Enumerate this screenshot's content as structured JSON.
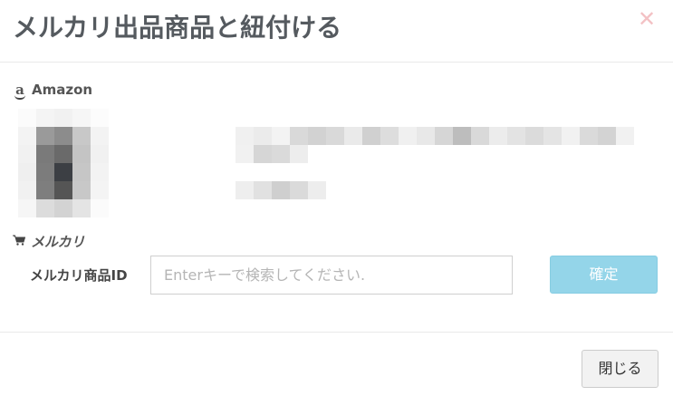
{
  "modal": {
    "title": "メルカリ出品商品と紐付ける",
    "close_icon": "close-x-icon",
    "close_color": "#f3c1c4"
  },
  "amazon": {
    "icon": "amazon-icon",
    "label": "Amazon"
  },
  "mercari": {
    "icon": "cart-icon",
    "label": "メルカリ",
    "id_label": "メルカリ商品ID",
    "id_input_value": "",
    "id_input_placeholder": "Enterキーで検索してください.",
    "confirm_label": "確定"
  },
  "footer": {
    "close_label": "閉じる"
  },
  "colors": {
    "confirm_button": "#94d5e9",
    "title": "#555a5f"
  }
}
